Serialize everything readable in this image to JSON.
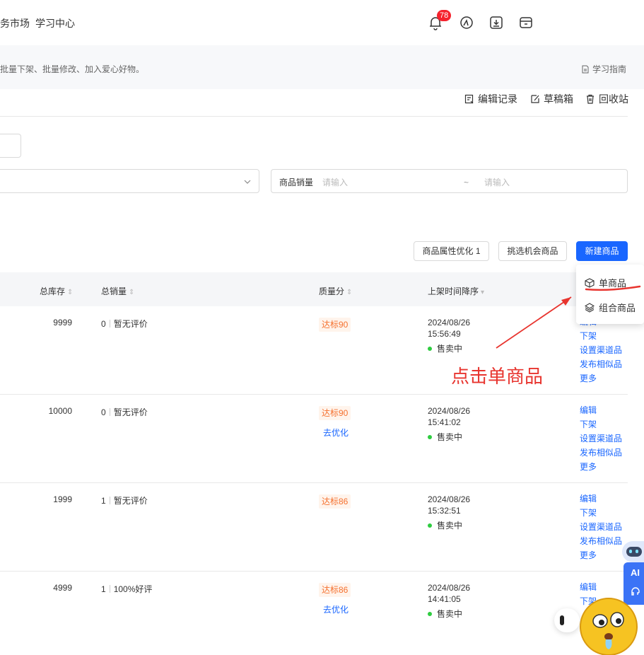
{
  "header": {
    "nav": [
      "务市场",
      "学习中心"
    ],
    "notification_count": "78",
    "icons": [
      "bell-icon",
      "gauge-icon",
      "download-icon",
      "shop-icon"
    ]
  },
  "notice": {
    "text": "批量下架、批量修改、加入爱心好物。",
    "guide_label": "学习指南"
  },
  "tools": {
    "edit_history": "编辑记录",
    "drafts": "草稿箱",
    "recycle_bin": "回收站"
  },
  "filters": {
    "sales_label": "商品销量",
    "sales_min_placeholder": "请输入",
    "range_sep": "~",
    "sales_max_placeholder": "请输入"
  },
  "actions": {
    "attr_optimize": "商品属性优化 1",
    "pick_opportunity": "挑选机会商品",
    "new_product": "新建商品"
  },
  "dropdown": {
    "single": "单商品",
    "combo": "组合商品"
  },
  "annotation": "点击单商品",
  "table": {
    "columns": {
      "stock": "总库存",
      "sales": "总销量",
      "quality": "质量分",
      "listed_time": "上架时间降序"
    },
    "rows": [
      {
        "stock": "9999",
        "sales": "0",
        "review": "暂无评价",
        "quality": "达标90",
        "optimize": "",
        "date": "2024/08/26",
        "time": "15:56:49",
        "status": "售卖中",
        "actions": [
          "编辑",
          "下架",
          "设置渠道品",
          "发布相似品",
          "更多"
        ]
      },
      {
        "stock": "10000",
        "sales": "0",
        "review": "暂无评价",
        "quality": "达标90",
        "optimize": "去优化",
        "date": "2024/08/26",
        "time": "15:41:02",
        "status": "售卖中",
        "actions": [
          "编辑",
          "下架",
          "设置渠道品",
          "发布相似品",
          "更多"
        ]
      },
      {
        "stock": "1999",
        "sales": "1",
        "review": "暂无评价",
        "quality": "达标86",
        "optimize": "",
        "date": "2024/08/26",
        "time": "15:32:51",
        "status": "售卖中",
        "actions": [
          "编辑",
          "下架",
          "设置渠道品",
          "发布相似品",
          "更多"
        ]
      },
      {
        "stock": "4999",
        "sales": "1",
        "review": "100%好评",
        "quality": "达标86",
        "optimize": "去优化",
        "date": "2024/08/26",
        "time": "14:41:05",
        "status": "售卖中",
        "actions": [
          "编辑",
          "下架"
        ]
      }
    ]
  },
  "widgets": {
    "ai_label": "AI"
  },
  "colors": {
    "primary": "#1966ff",
    "quality_tag": "#f5702e",
    "badge": "#f5222d",
    "annotation": "#e8352f",
    "status_dot": "#2ecc40"
  }
}
